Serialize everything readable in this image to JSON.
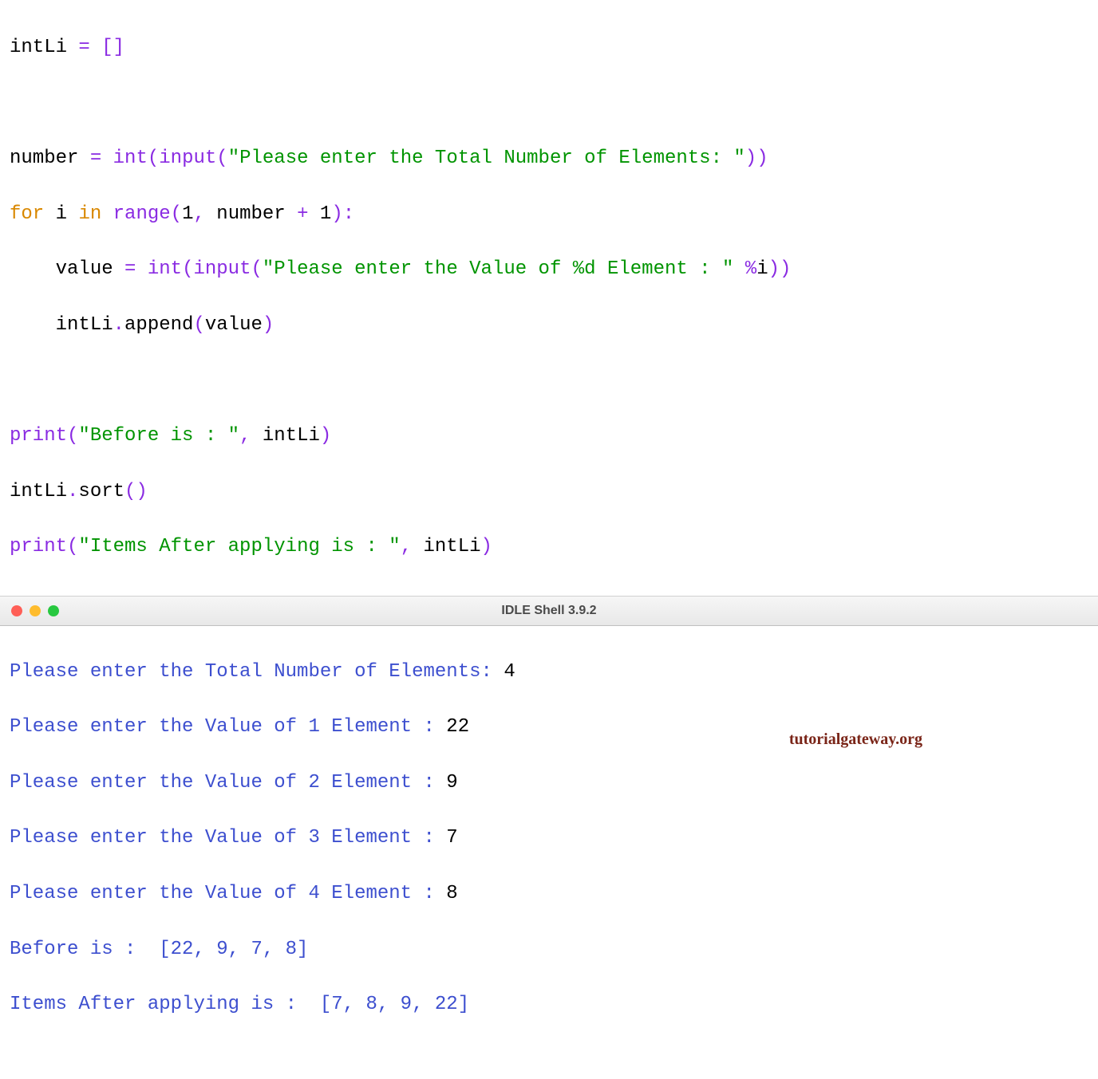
{
  "code": {
    "l1_a": "intLi ",
    "l1_b": "=",
    "l1_c": " ",
    "l1_d": "[]",
    "l3_a": "number ",
    "l3_b": "=",
    "l3_c": " ",
    "l3_d": "int",
    "l3_e": "(",
    "l3_f": "input",
    "l3_g": "(",
    "l3_h": "\"Please enter the Total Number of Elements: \"",
    "l3_i": "))",
    "l4_a": "for",
    "l4_b": " i ",
    "l4_c": "in",
    "l4_d": " ",
    "l4_e": "range",
    "l4_f": "(",
    "l4_g": "1",
    "l4_h": ",",
    "l4_i": " number ",
    "l4_j": "+",
    "l4_k": " ",
    "l4_l": "1",
    "l4_m": "):",
    "l5_a": "    value ",
    "l5_b": "=",
    "l5_c": " ",
    "l5_d": "int",
    "l5_e": "(",
    "l5_f": "input",
    "l5_g": "(",
    "l5_h": "\"Please enter the Value of %d Element : \"",
    "l5_i": " ",
    "l5_j": "%",
    "l5_k": "i",
    "l5_l": "))",
    "l6_a": "    intLi",
    "l6_b": ".",
    "l6_c": "append",
    "l6_d": "(",
    "l6_e": "value",
    "l6_f": ")",
    "l8_a": "print",
    "l8_b": "(",
    "l8_c": "\"Before is : \"",
    "l8_d": ",",
    "l8_e": " intLi",
    "l8_f": ")",
    "l9_a": "intLi",
    "l9_b": ".",
    "l9_c": "sort",
    "l9_d": "()",
    "l10_a": "print",
    "l10_b": "(",
    "l10_c": "\"Items After applying is : \"",
    "l10_d": ",",
    "l10_e": " intLi",
    "l10_f": ")"
  },
  "window": {
    "title": "IDLE Shell 3.9.2"
  },
  "shell": {
    "p1": "Please enter the Total Number of Elements: ",
    "v1": "4",
    "p2": "Please enter the Value of 1 Element : ",
    "v2": "22",
    "p3": "Please enter the Value of 2 Element : ",
    "v3": "9",
    "p4": "Please enter the Value of 3 Element : ",
    "v4": "7",
    "p5": "Please enter the Value of 4 Element : ",
    "v5": "8",
    "o1": "Before is :  [22, 9, 7, 8]",
    "o2": "Items After applying is :  [7, 8, 9, 22]"
  },
  "watermark": "tutorialgateway.org"
}
